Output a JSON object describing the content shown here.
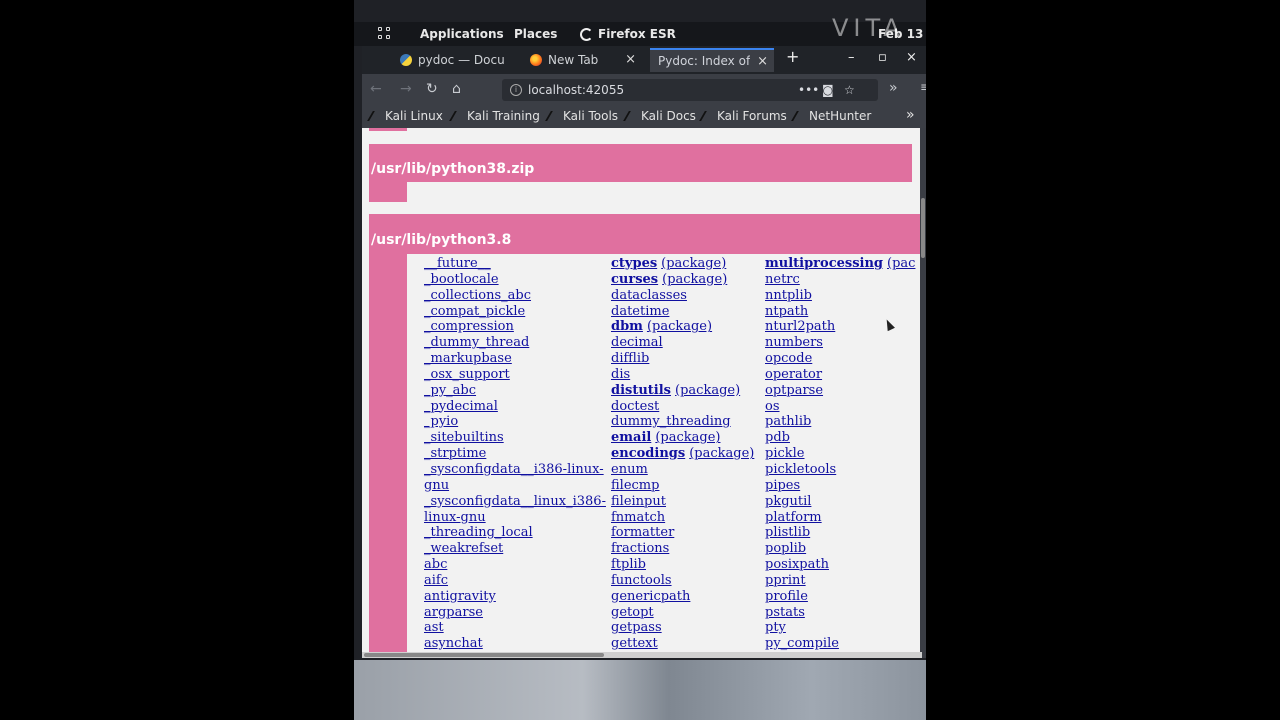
{
  "desktop": {
    "menu_applications": "Applications",
    "menu_places": "Places",
    "active_app": "Firefox ESR",
    "clock": "Feb 13",
    "watermark": "VITA"
  },
  "browser": {
    "tabs": [
      {
        "label": "pydoc — Docu",
        "close": "×"
      },
      {
        "label": "New Tab",
        "close": "×"
      },
      {
        "label": "Pydoc: Index of M",
        "close": "×"
      }
    ],
    "new_tab": "+",
    "window_controls": {
      "minimize": "–",
      "maximize": "▫",
      "close": "×"
    },
    "url": "localhost:42055",
    "bookmarks": [
      "Kali Linux",
      "Kali Training",
      "Kali Tools",
      "Kali Docs",
      "Kali Forums",
      "NetHunter"
    ],
    "bookmarks_more": "»"
  },
  "page": {
    "section1_title": "/usr/lib/python38.zip",
    "section2_title": "/usr/lib/python3.8",
    "column1": [
      {
        "name": "__future__"
      },
      {
        "name": "_bootlocale"
      },
      {
        "name": "_collections_abc"
      },
      {
        "name": "_compat_pickle"
      },
      {
        "name": "_compression"
      },
      {
        "name": "_dummy_thread"
      },
      {
        "name": "_markupbase"
      },
      {
        "name": "_osx_support"
      },
      {
        "name": "_py_abc"
      },
      {
        "name": "_pydecimal"
      },
      {
        "name": "_pyio"
      },
      {
        "name": "_sitebuiltins"
      },
      {
        "name": "_strptime"
      },
      {
        "name": "_sysconfigdata__i386-linux-"
      },
      {
        "name": "gnu"
      },
      {
        "name": "_sysconfigdata__linux_i386-"
      },
      {
        "name": "linux-gnu"
      },
      {
        "name": "_threading_local"
      },
      {
        "name": "_weakrefset"
      },
      {
        "name": "abc"
      },
      {
        "name": "aifc"
      },
      {
        "name": "antigravity"
      },
      {
        "name": "argparse"
      },
      {
        "name": "ast"
      },
      {
        "name": "asynchat"
      }
    ],
    "column2": [
      {
        "name": "ctypes",
        "pkg": "(package)"
      },
      {
        "name": "curses",
        "pkg": "(package)"
      },
      {
        "name": "dataclasses"
      },
      {
        "name": "datetime"
      },
      {
        "name": "dbm",
        "pkg": "(package)"
      },
      {
        "name": "decimal"
      },
      {
        "name": "difflib"
      },
      {
        "name": "dis"
      },
      {
        "name": "distutils",
        "pkg": "(package)"
      },
      {
        "name": "doctest"
      },
      {
        "name": "dummy_threading"
      },
      {
        "name": "email",
        "pkg": "(package)"
      },
      {
        "name": "encodings",
        "pkg": "(package)"
      },
      {
        "name": "enum"
      },
      {
        "name": "filecmp"
      },
      {
        "name": "fileinput"
      },
      {
        "name": "fnmatch"
      },
      {
        "name": "formatter"
      },
      {
        "name": "fractions"
      },
      {
        "name": "ftplib"
      },
      {
        "name": "functools"
      },
      {
        "name": "genericpath"
      },
      {
        "name": "getopt"
      },
      {
        "name": "getpass"
      },
      {
        "name": "gettext"
      }
    ],
    "column3": [
      {
        "name": "multiprocessing",
        "pkg": "(pac"
      },
      {
        "name": "netrc"
      },
      {
        "name": "nntplib"
      },
      {
        "name": "ntpath"
      },
      {
        "name": "nturl2path"
      },
      {
        "name": "numbers"
      },
      {
        "name": "opcode"
      },
      {
        "name": "operator"
      },
      {
        "name": "optparse"
      },
      {
        "name": "os"
      },
      {
        "name": "pathlib"
      },
      {
        "name": "pdb"
      },
      {
        "name": "pickle"
      },
      {
        "name": "pickletools"
      },
      {
        "name": "pipes"
      },
      {
        "name": "pkgutil"
      },
      {
        "name": "platform"
      },
      {
        "name": "plistlib"
      },
      {
        "name": "poplib"
      },
      {
        "name": "posixpath"
      },
      {
        "name": "pprint"
      },
      {
        "name": "profile"
      },
      {
        "name": "pstats"
      },
      {
        "name": "pty"
      },
      {
        "name": "py_compile"
      }
    ]
  }
}
